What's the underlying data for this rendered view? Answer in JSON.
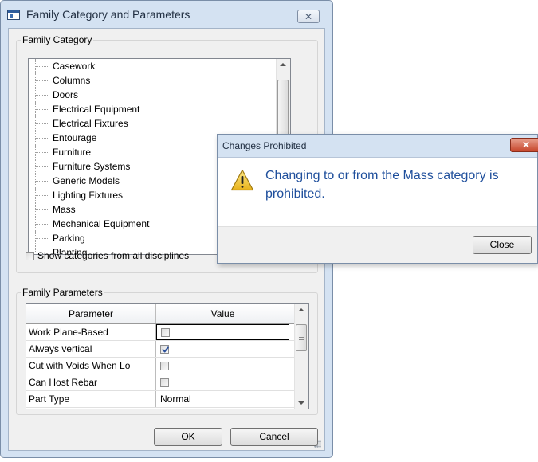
{
  "dialog": {
    "title": "Family Category and Parameters",
    "close_glyph": "✕",
    "category_group_label": "Family Category",
    "categories": [
      "Casework",
      "Columns",
      "Doors",
      "Electrical Equipment",
      "Electrical Fixtures",
      "Entourage",
      "Furniture",
      "Furniture Systems",
      "Generic Models",
      "Lighting Fixtures",
      "Mass",
      "Mechanical Equipment",
      "Parking",
      "Planting"
    ],
    "show_all_label": "Show categories from all disciplines",
    "show_all_checked": false,
    "params_group_label": "Family Parameters",
    "param_headers": {
      "parameter": "Parameter",
      "value": "Value"
    },
    "params": [
      {
        "name": "Work Plane-Based",
        "type": "checkbox",
        "checked": false,
        "value": ""
      },
      {
        "name": "Always vertical",
        "type": "checkbox",
        "checked": true,
        "value": ""
      },
      {
        "name": "Cut with Voids When Lo",
        "type": "checkbox",
        "checked": false,
        "value": ""
      },
      {
        "name": "Can Host Rebar",
        "type": "checkbox",
        "checked": false,
        "value": ""
      },
      {
        "name": "Part Type",
        "type": "text",
        "checked": false,
        "value": "Normal"
      }
    ],
    "ok_label": "OK",
    "cancel_label": "Cancel"
  },
  "message_box": {
    "title": "Changes Prohibited",
    "close_glyph": "✕",
    "icon": "warning-icon",
    "text": "Changing to or from the Mass category is prohibited.",
    "close_label": "Close"
  },
  "colors": {
    "chrome": "#d4e2f2",
    "message_text": "#1f4f9c",
    "close_red": "#c6452a"
  }
}
